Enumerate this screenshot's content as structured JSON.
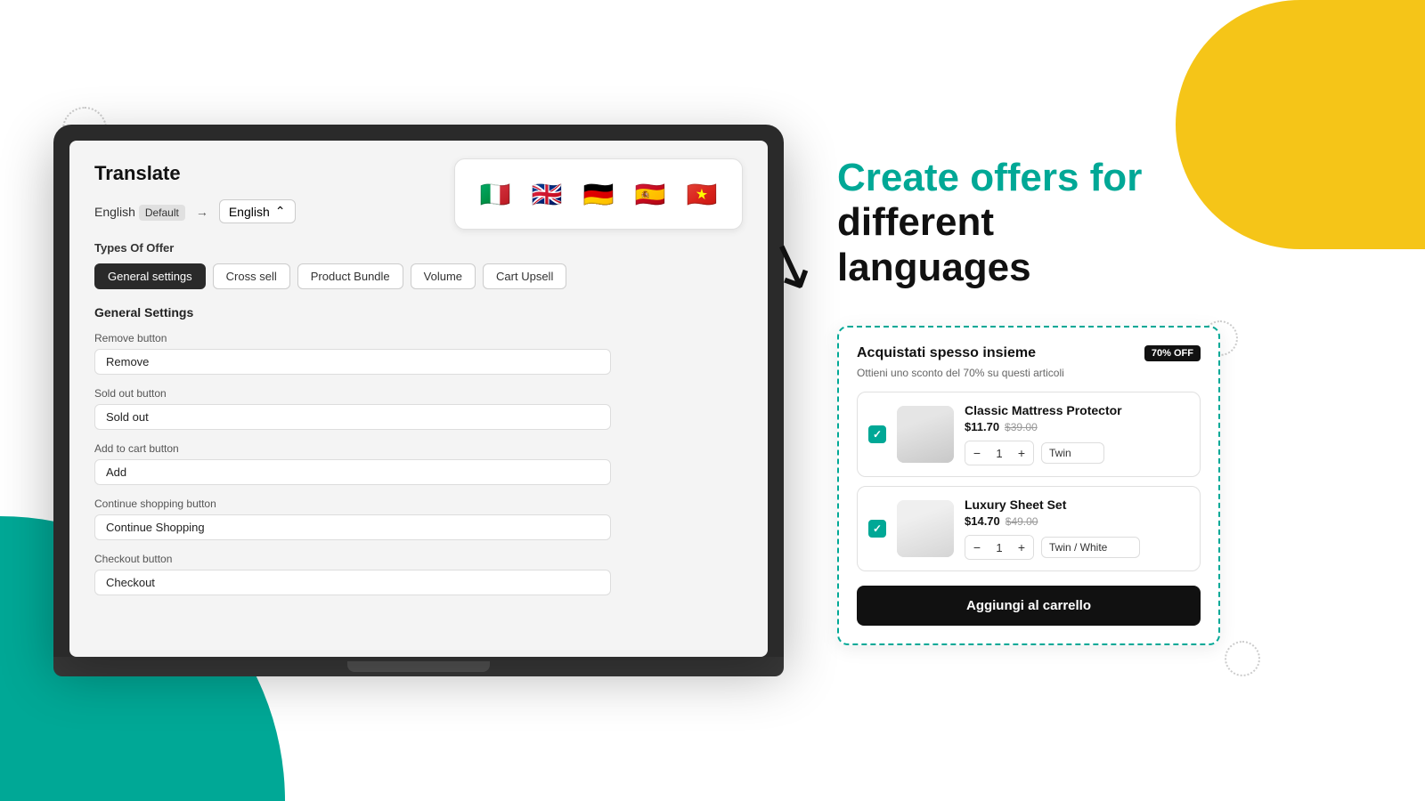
{
  "page": {
    "background": {
      "teal_shape": true,
      "yellow_shape": true
    }
  },
  "laptop": {
    "screen": {
      "translate_title": "Translate",
      "lang_source": "English",
      "lang_source_badge": "Default",
      "lang_arrow": "→",
      "lang_target_label": "English",
      "lang_target_chevron": "⌃",
      "flags": [
        "🇮🇹",
        "🇬🇧",
        "🇩🇪",
        "🇪🇸",
        "🇻🇳"
      ],
      "types_of_offer_label": "Types Of Offer",
      "tabs": [
        {
          "label": "General settings",
          "active": true
        },
        {
          "label": "Cross sell",
          "active": false
        },
        {
          "label": "Product Bundle",
          "active": false
        },
        {
          "label": "Volume",
          "active": false
        },
        {
          "label": "Cart Upsell",
          "active": false
        }
      ],
      "general_settings_title": "General Settings",
      "fields": [
        {
          "label": "Remove button",
          "value": "Remove"
        },
        {
          "label": "Sold out button",
          "value": "Sold out"
        },
        {
          "label": "Add to cart button",
          "value": "Add"
        },
        {
          "label": "Continue shopping button",
          "value": "Continue Shopping"
        },
        {
          "label": "Checkout button",
          "value": "Checkout"
        }
      ]
    }
  },
  "headline": {
    "line1": "Create offers for",
    "line2": "different",
    "line3": "languages"
  },
  "product_widget": {
    "title": "Acquistati spesso insieme",
    "discount_badge": "70% OFF",
    "subtitle": "Ottieni uno sconto del 70% su questi articoli",
    "products": [
      {
        "name": "Classic Mattress Protector",
        "price_current": "$11.70",
        "price_original": "$39.00",
        "qty": "1",
        "variant": "Twin",
        "checked": true
      },
      {
        "name": "Luxury Sheet Set",
        "price_current": "$14.70",
        "price_original": "$49.00",
        "qty": "1",
        "variant": "Twin / White",
        "checked": true
      }
    ],
    "cta_button": "Aggiungi al carrello"
  }
}
